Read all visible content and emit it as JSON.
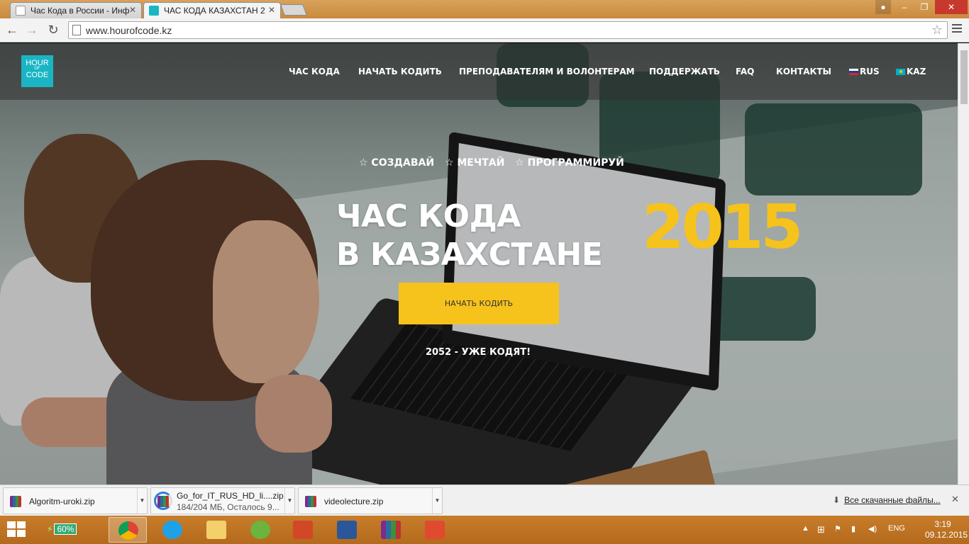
{
  "browser": {
    "tabs": [
      {
        "title": "Час Кода в России - Инф",
        "active": false
      },
      {
        "title": "ЧАС КОДА КАЗАХСТАН 2",
        "active": true
      }
    ],
    "url": "www.hourofcode.kz",
    "window_buttons": {
      "minimize": "–",
      "maximize": "❐",
      "close": "✕"
    }
  },
  "site": {
    "logo": {
      "line1": "HOUR",
      "line2": "OF",
      "line3": "CODE"
    },
    "nav": [
      "ЧАС КОДА",
      "НАЧАТЬ КОДИТЬ",
      "ПРЕПОДАВАТЕЛЯМ И ВОЛОНТЕРАМ",
      "ПОДДЕРЖАТЬ",
      "FAQ",
      "КОНТАКТЫ"
    ],
    "languages": [
      "RUS",
      "KAZ"
    ],
    "taglines": [
      "☆ СОЗДАВАЙ",
      "☆ МЕЧТАЙ",
      "☆ ПРОГРАММИРУЙ"
    ],
    "hero_line1": "ЧАС КОДА",
    "hero_line2": "В КАЗАХСТАНЕ",
    "hero_year": "2015",
    "cta_label": "НАЧАТЬ КОДИТЬ",
    "counter": "2052 - УЖЕ КОДЯТ!"
  },
  "downloads": {
    "items": [
      {
        "name": "Algoritm-uroki.zip",
        "status": ""
      },
      {
        "name": "Go_for_IT_RUS_HD_li....zip",
        "status": "184/204 МБ, Осталось 9..."
      },
      {
        "name": "videolecture.zip",
        "status": ""
      }
    ],
    "all_label": "Все скачанные файлы...",
    "close": "✕"
  },
  "taskbar": {
    "battery": "60%",
    "language": "ENG",
    "time": "3:19",
    "date": "09.12.2015"
  }
}
